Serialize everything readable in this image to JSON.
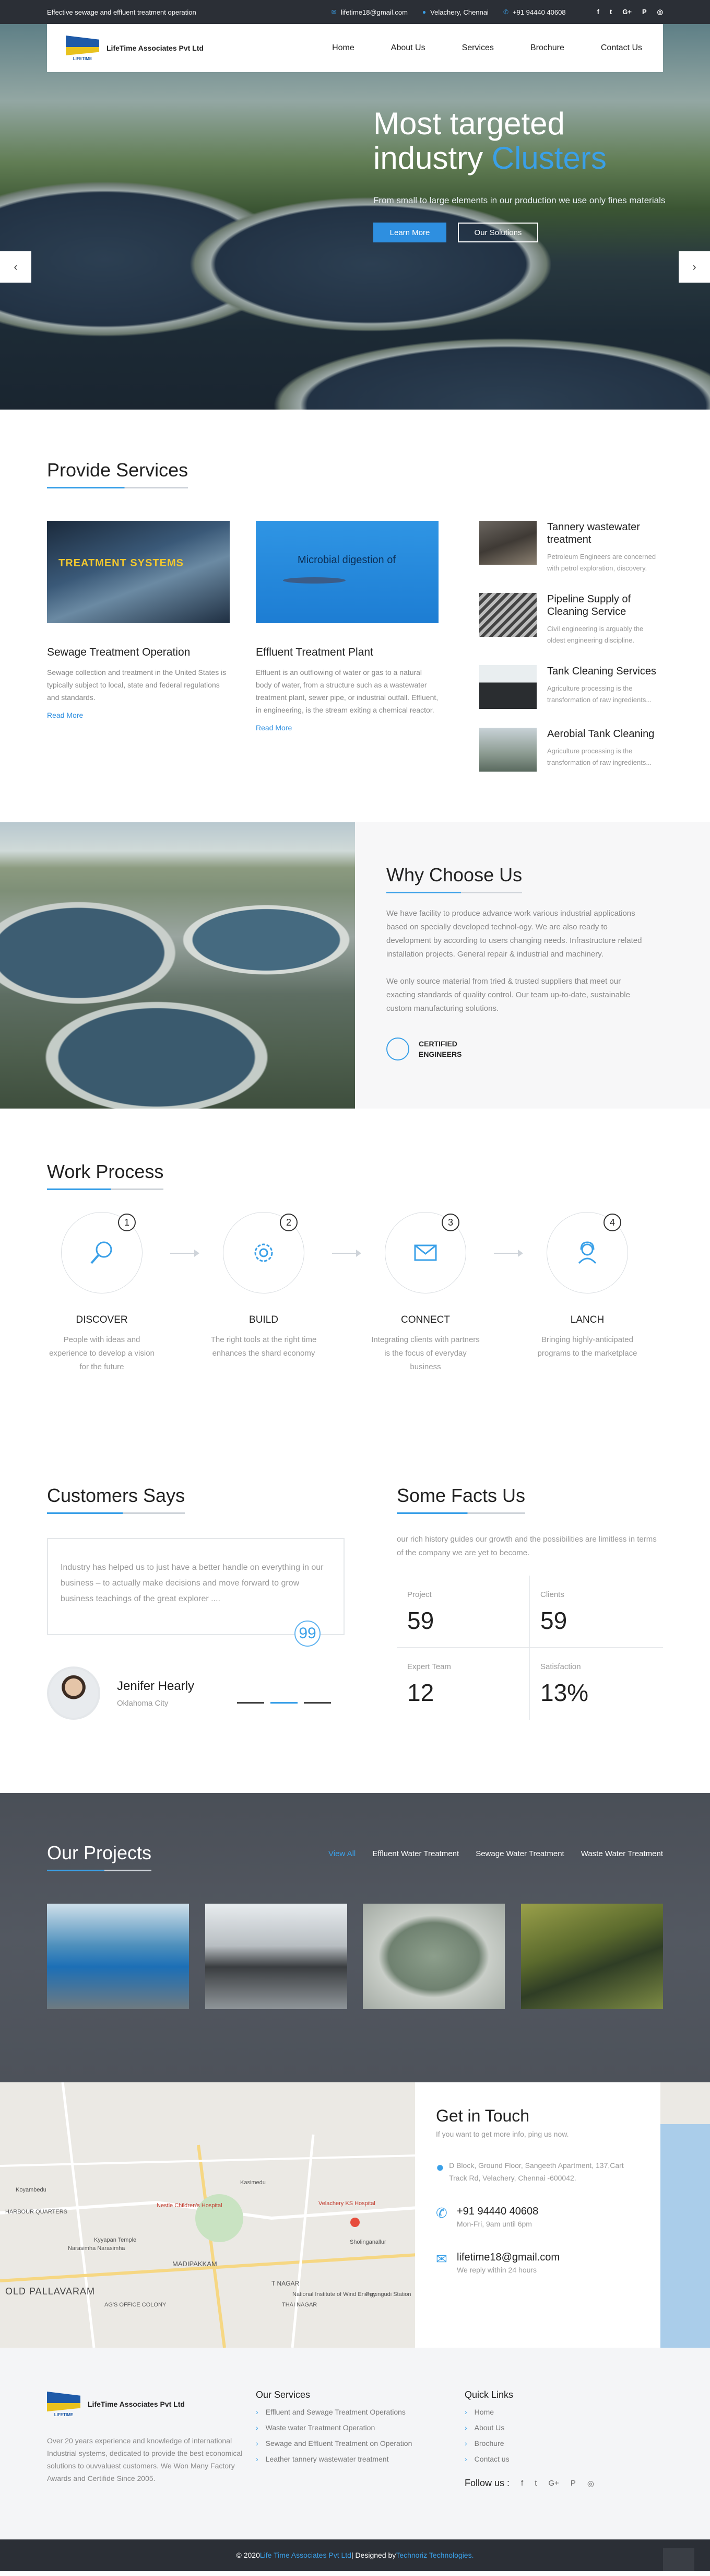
{
  "topbar": {
    "tagline": "Effective sewage and effluent treatment operation",
    "email": "lifetime18@gmail.com",
    "location": "Velachery, Chennai",
    "phone": "+91 94440 40608",
    "social": [
      "f",
      "t",
      "G+",
      "P",
      "◎"
    ]
  },
  "nav": {
    "logo_text": "LifeTime Associates Pvt Ltd",
    "logo_sub": "LIFETIME",
    "items": [
      "Home",
      "About Us",
      "Services",
      "Brochure",
      "Contact Us"
    ]
  },
  "hero": {
    "line1": "Most targeted",
    "line2a": "industry ",
    "line2b": "Clusters",
    "desc": "From small to large elements in our production we use only fines materials",
    "btn1": "Learn More",
    "btn2": "Our Solutions",
    "prev": "‹",
    "next": "›"
  },
  "services": {
    "title": "Provide Services",
    "cards": [
      {
        "title": "Sewage Treatment Operation",
        "text": "Sewage collection and treatment in the United States is typically subject to local, state and federal regulations and standards.",
        "more": "Read More",
        "img_text": "TREATMENT SYSTEMS"
      },
      {
        "title": "Effluent Treatment Plant",
        "text": "Effluent is an outflowing of water or gas to a natural body of water, from a structure such as a wastewater treatment plant, sewer pipe, or industrial outfall. Effluent, in engineering, is the stream exiting a chemical reactor.",
        "more": "Read More",
        "img_text": "Microbial digestion of"
      }
    ],
    "list": [
      {
        "title": "Tannery wastewater treatment",
        "text": "Petroleum Engineers are concerned with petrol exploration, discovery."
      },
      {
        "title": "Pipeline Supply of Cleaning Service",
        "text": "Civil engineering is arguably the oldest engineering discipline."
      },
      {
        "title": "Tank Cleaning Services",
        "text": "Agriculture processing is the transformation of raw ingredients..."
      },
      {
        "title": "Aerobial Tank Cleaning",
        "text": "Agriculture processing is the transformation of raw ingredients..."
      }
    ]
  },
  "why": {
    "title": "Why Choose Us",
    "p1": "We have facility to produce advance work various industrial applications based on specially developed technol-ogy. We are also ready to development by according to users changing needs. Infrastructure related installation projects. General repair & industrial and machinery.",
    "p2": "We only source material from tried & trusted suppliers that meet our exacting standards of quality control. Our team up-to-date, sustainable custom manufacturing solutions.",
    "cert1": "CERTIFIED",
    "cert2": "ENGINEERS"
  },
  "work": {
    "title": "Work Process",
    "steps": [
      {
        "num": "1",
        "title": "DISCOVER",
        "text": "People with ideas and experience to develop a vision for the future",
        "icon": "search-icon"
      },
      {
        "num": "2",
        "title": "BUILD",
        "text": "The right tools at the right time enhances the shard economy",
        "icon": "gear-icon"
      },
      {
        "num": "3",
        "title": "CONNECT",
        "text": "Integrating clients with partners is the focus of everyday business",
        "icon": "mail-icon"
      },
      {
        "num": "4",
        "title": "LANCH",
        "text": "Bringing highly-anticipated programs to the marketplace",
        "icon": "support-icon"
      }
    ]
  },
  "customers": {
    "title": "Customers Says",
    "quote": "Industry has helped us to just have a better handle on everything in our business – to actually make decisions and move forward to grow business teachings of the great explorer ....",
    "quote_mark": "99",
    "name": "Jenifer Hearly",
    "city": "Oklahoma City"
  },
  "facts": {
    "title": "Some Facts Us",
    "lead": "our rich history guides our growth and the possibilities are limitless in terms of the company we are yet to become.",
    "items": [
      {
        "label": "Project",
        "value": "59"
      },
      {
        "label": "Clients",
        "value": "59"
      },
      {
        "label": "Expert Team",
        "value": "12"
      },
      {
        "label": "Satisfaction",
        "value": "13%"
      }
    ]
  },
  "projects": {
    "title": "Our Projects",
    "filters": [
      "View All",
      "Effluent Water Treatment",
      "Sewage Water Treatment",
      "Waste Water Treatment"
    ]
  },
  "contact": {
    "title": "Get in Touch",
    "sub": "If you want to get more info, ping us now.",
    "address": "D Block, Ground Floor, Sangeeth Apartment, 137,Cart Track Rd, Velachery, Chennai -600042.",
    "phone": "+91 94440 40608",
    "hours": "Mon-Fri, 9am until 6pm",
    "email": "lifetime18@gmail.com",
    "reply": "We reply within 24 hours",
    "map_labels": [
      "HARBOUR QUARTERS",
      "Nestle Children's Hospital",
      "Velachery KS Hospital",
      "Sholinganallur",
      "Koyambedu",
      "Kasimedu",
      "MADIPAKKAM",
      "T NAGAR",
      "OLD PALLAVARAM",
      "AG'S OFFICE COLONY",
      "THAI NAGAR",
      "Perungudi Station",
      "National Institute of Wind Energy",
      "Kyyapan Temple",
      "Narasimha Narasimha"
    ]
  },
  "footer": {
    "logo_text": "LifeTime Associates Pvt Ltd",
    "about": "Over 20 years experience and knowledge of international Industrial systems, dedicated to provide the best economical solutions to ouvvaluest customers. We Won Many Factory Awards and Certifide Since 2005.",
    "services_title": "Our Services",
    "services": [
      "Effluent and Sewage Treatment Operations",
      "Waste water Treatment Operation",
      "Sewage and Effluent Treatment on Operation",
      "Leather tannery wastewater treatment"
    ],
    "links_title": "Quick Links",
    "links": [
      "Home",
      "About Us",
      "Brochure",
      "Contact us"
    ],
    "follow": "Follow us :",
    "social": [
      "f",
      "t",
      "G+",
      "P",
      "◎"
    ]
  },
  "bottom": {
    "pre": "© 2020 ",
    "company": "Life Time Associates Pvt Ltd",
    "mid": " | Designed by ",
    "designer": "Technoriz Technologies."
  }
}
